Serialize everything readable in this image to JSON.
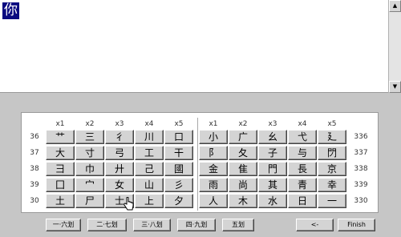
{
  "editor": {
    "composed_char": "你"
  },
  "scrollbar": {
    "up_glyph": "▲",
    "down_glyph": "▼"
  },
  "keyboard": {
    "col_headers_left": [
      "x1",
      "x2",
      "x3",
      "x4",
      "x5"
    ],
    "col_headers_right": [
      "x1",
      "x2",
      "x3",
      "x4",
      "x5"
    ],
    "row_labels_left": [
      "36",
      "37",
      "38",
      "39",
      "30"
    ],
    "row_labels_right": [
      "336",
      "337",
      "338",
      "339",
      "330"
    ],
    "rows": [
      [
        "艹",
        "三",
        "彳",
        "川",
        "口",
        "小",
        "广",
        "幺",
        "弋",
        "廴"
      ],
      [
        "大",
        "寸",
        "弓",
        "工",
        "干",
        "阝",
        "夂",
        "子",
        "与",
        "閁"
      ],
      [
        "彐",
        "巾",
        "廾",
        "己",
        "國",
        "金",
        "隹",
        "門",
        "長",
        "京"
      ],
      [
        "囗",
        "宀",
        "女",
        "山",
        "彡",
        "雨",
        "尚",
        "其",
        "青",
        "幸"
      ],
      [
        "土",
        "尸",
        "士",
        "上",
        "夕",
        "人",
        "木",
        "水",
        "日",
        "一"
      ]
    ]
  },
  "buttons": {
    "stroke_1_6": "一·六划",
    "stroke_2_7": "二·七划",
    "stroke_3_8": "三·八划",
    "stroke_4_9": "四·九划",
    "stroke_5": "五划",
    "backspace": "<-",
    "finish": "Finish"
  }
}
